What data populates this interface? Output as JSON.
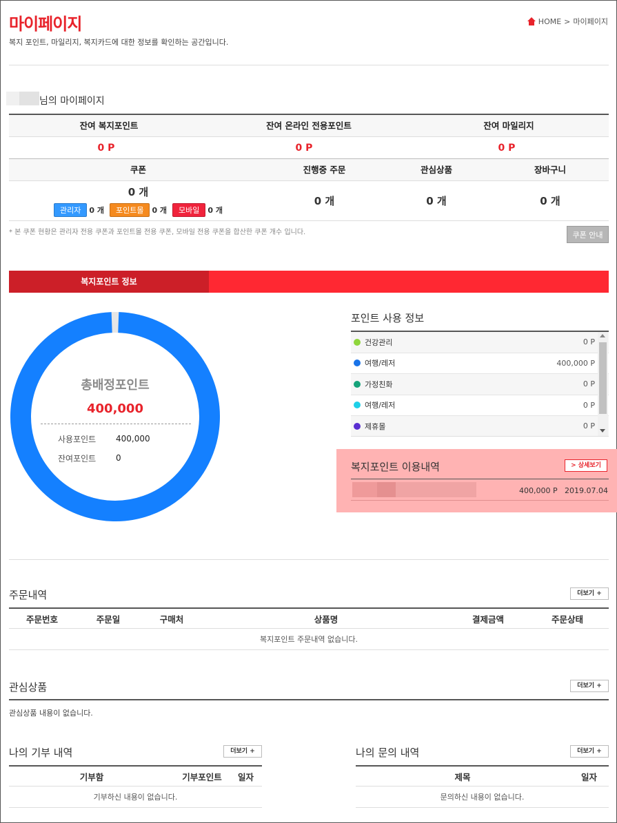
{
  "page": {
    "title": "마이페이지",
    "subtitle": "복지 포인트, 마일리지, 복지카드에 대한 정보를 확인하는 공간입니다.",
    "breadcrumb": {
      "home": "HOME",
      "sep": ">",
      "current": "마이페이지"
    }
  },
  "user": {
    "mypage_label": "님의 마이페이지"
  },
  "summary": {
    "welfare_label": "잔여 복지포인트",
    "welfare_value": "0 P",
    "online_label": "잔여 온라인 전용포인트",
    "online_value": "0 P",
    "mileage_label": "잔여 마일리지",
    "mileage_value": "0 P",
    "coupon_label": "쿠폰",
    "coupon_value": "0 개",
    "orders_label": "진행중 주문",
    "orders_value": "0 개",
    "wish_label": "관심상품",
    "wish_value": "0 개",
    "cart_label": "장바구니",
    "cart_value": "0 개",
    "coupon_types": [
      {
        "label": "관리자",
        "count": "0 개",
        "color": "#3399ff"
      },
      {
        "label": "포인트몰",
        "count": "0 개",
        "color": "#f58a1f"
      },
      {
        "label": "모바일",
        "count": "0 개",
        "color": "#f0233c"
      }
    ],
    "note": "* 본 쿠폰 현황은 관리자 전용 쿠폰과 포인트몰 전용 쿠폰, 모바일 전용 쿠폰을 합산한 쿠폰 개수 입니다.",
    "coupon_guide": "쿠폰 안내"
  },
  "welfare": {
    "tab": "복지포인트 정보",
    "donut": {
      "title": "총배정포인트",
      "total": "400,000",
      "used_label": "사용포인트",
      "used_value": "400,000",
      "remain_label": "잔여포인트",
      "remain_value": "0",
      "used_fraction": 1.0,
      "color": "#1480ff"
    },
    "usage_title": "포인트 사용 정보",
    "usage_items": [
      {
        "name": "건강관리",
        "value": "0 P",
        "color": "#8fd63c"
      },
      {
        "name": "여행/레저",
        "value": "400,000 P",
        "color": "#1a73e8"
      },
      {
        "name": "가정친화",
        "value": "0 P",
        "color": "#16a37a"
      },
      {
        "name": "여행/레저",
        "value": "0 P",
        "color": "#1ed0e8"
      },
      {
        "name": "제휴몰",
        "value": "0 P",
        "color": "#5a2fd1"
      }
    ],
    "history_title": "복지포인트 이용내역",
    "history_more": "> 상세보기",
    "history_row": {
      "amount": "400,000 P",
      "date": "2019.07.04"
    }
  },
  "orders": {
    "title": "주문내역",
    "more": "더보기 +",
    "columns": [
      "주문번호",
      "주문일",
      "구매처",
      "상품명",
      "결제금액",
      "주문상태"
    ],
    "empty": "복지포인트 주문내역 없습니다."
  },
  "wishlist": {
    "title": "관심상품",
    "more": "더보기 +",
    "empty": "관심상품 내용이 없습니다."
  },
  "donation": {
    "title": "나의 기부 내역",
    "more": "더보기 +",
    "columns": [
      "기부함",
      "기부포인트",
      "일자"
    ],
    "empty": "기부하신 내용이 없습니다."
  },
  "inquiry": {
    "title": "나의 문의 내역",
    "more": "더보기 +",
    "columns": [
      "제목",
      "일자"
    ],
    "empty": "문의하신 내용이 없습니다."
  }
}
